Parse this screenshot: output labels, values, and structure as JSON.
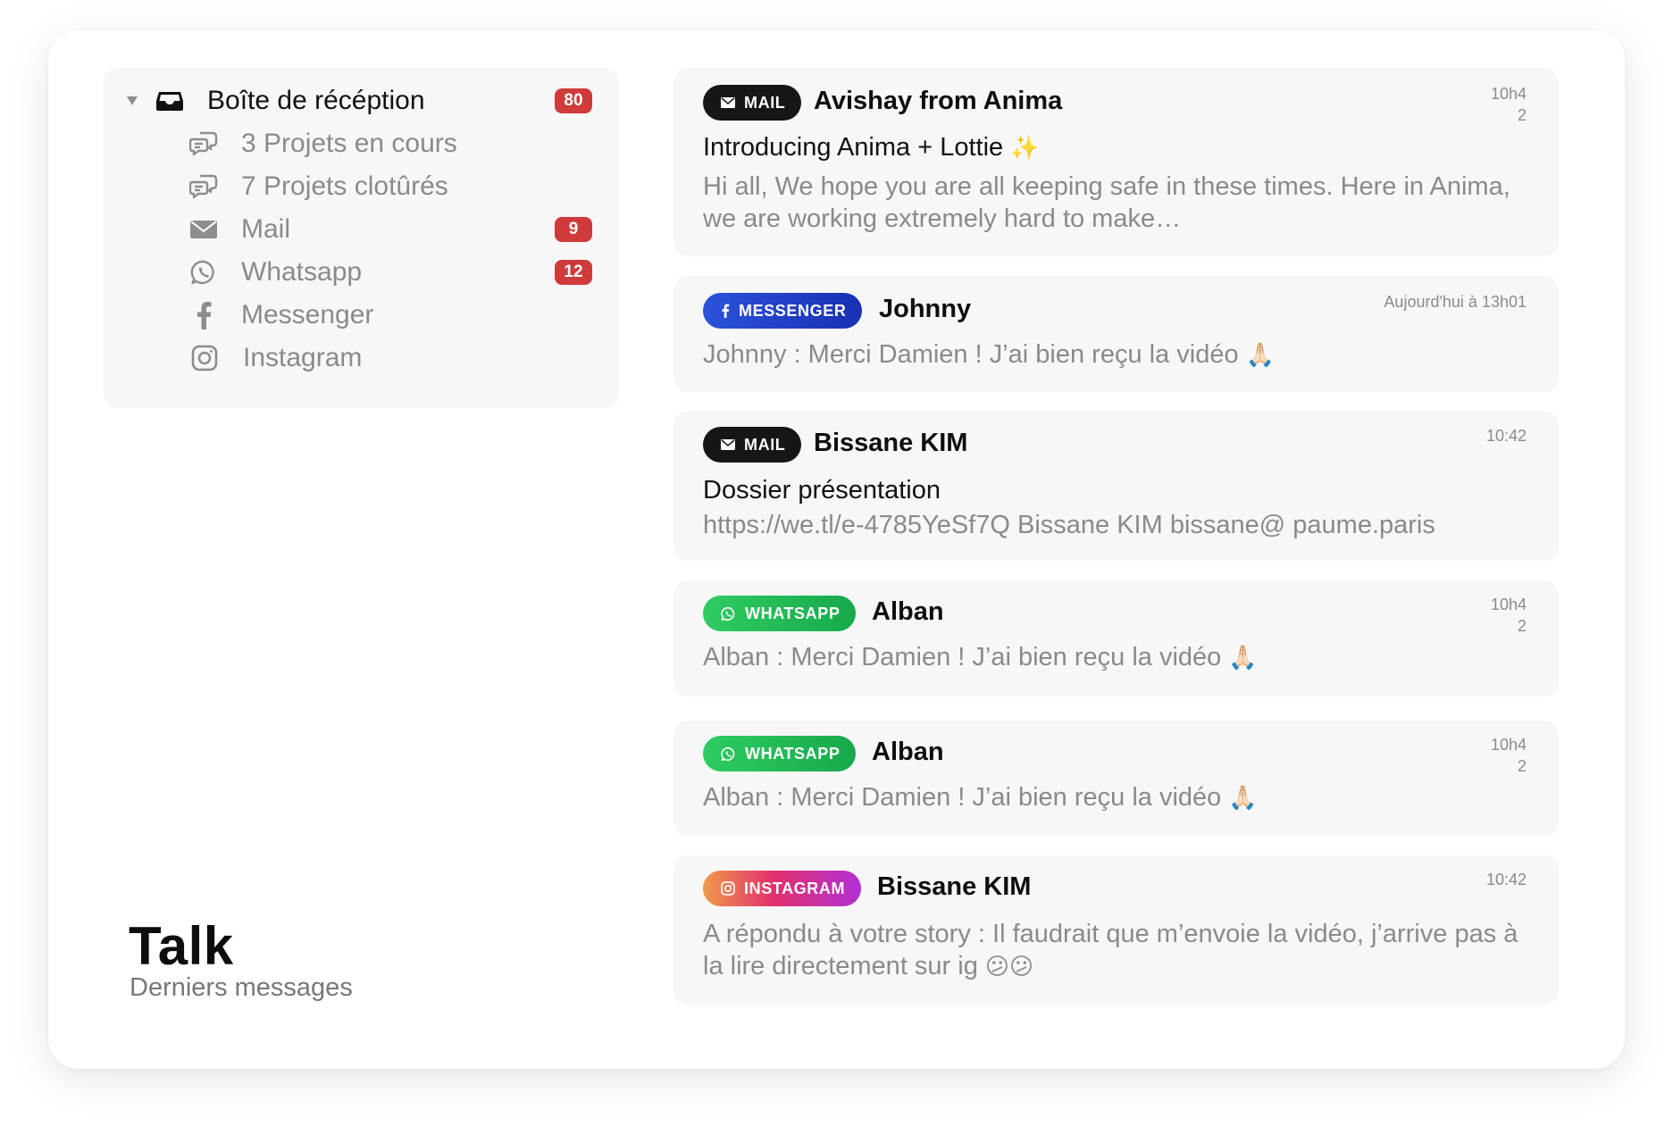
{
  "app": {
    "title": "Talk",
    "subtitle": "Derniers messages"
  },
  "sidebar": {
    "inbox": {
      "label": "Boîte de récéption",
      "badge": "80",
      "icon": "inbox-icon"
    },
    "items": [
      {
        "label": "3 Projets en cours",
        "icon": "chat-bubbles-icon",
        "badge": ""
      },
      {
        "label": "7 Projets clotûrés",
        "icon": "chat-bubbles-icon",
        "badge": ""
      },
      {
        "label": "Mail",
        "icon": "envelope-icon",
        "badge": "9"
      },
      {
        "label": "Whatsapp",
        "icon": "whatsapp-icon",
        "badge": "12"
      },
      {
        "label": "Messenger",
        "icon": "facebook-icon",
        "badge": ""
      },
      {
        "label": "Instagram",
        "icon": "instagram-icon",
        "badge": ""
      }
    ]
  },
  "colors": {
    "badge": "#cf3b3b",
    "mail": "#161616",
    "messenger": "#1f3fcc",
    "whatsapp": "#22bb55",
    "instagram": "#e1306c"
  },
  "messages": [
    {
      "channel": "MAIL",
      "sender": "Avishay from Anima",
      "time": "10h42",
      "subject": "Introducing Anima + Lottie",
      "subject_emoji": "✨",
      "preview": "Hi all, We hope you are all keeping safe in these times. Here in Anima, we are working extremely hard to make…"
    },
    {
      "channel": "MESSENGER",
      "sender": "Johnny",
      "time": "Aujourd'hui à 13h01",
      "preview": "Johnny : Merci Damien ! J’ai bien reçu la vidéo",
      "preview_emoji": "🙏🏻"
    },
    {
      "channel": "MAIL",
      "sender": "Bissane KIM",
      "time": "10:42",
      "subject": "Dossier présentation",
      "preview": "https://we.tl/e-4785YeSf7Q Bissane KIM bissane@ paume.paris"
    },
    {
      "channel": "WHATSAPP",
      "sender": "Alban",
      "time": "10h42",
      "preview": "Alban : Merci Damien ! J’ai bien reçu la vidéo",
      "preview_emoji": "🙏🏻"
    },
    {
      "channel": "WHATSAPP",
      "sender": "Alban",
      "time": "10h42",
      "preview": "Alban : Merci Damien ! J’ai bien reçu la vidéo",
      "preview_emoji": "🙏🏻"
    },
    {
      "channel": "INSTAGRAM",
      "sender": "Bissane KIM",
      "time": "10:42",
      "preview": "A répondu à votre story : Il faudrait que m’envoie la vidéo, j’arrive pas à la lire directement sur ig",
      "preview_emoji": "😕😕"
    }
  ]
}
